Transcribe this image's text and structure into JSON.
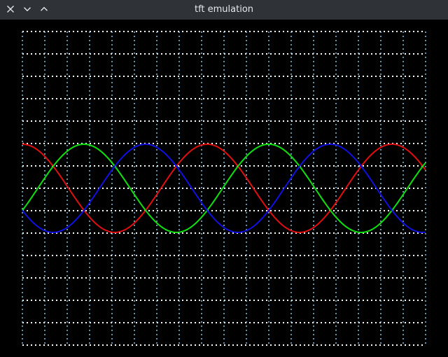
{
  "window": {
    "title": "tft emulation",
    "controls": [
      {
        "name": "close",
        "icon": "close-icon"
      },
      {
        "name": "minimize",
        "icon": "chevron-down-icon"
      },
      {
        "name": "maximize",
        "icon": "chevron-up-icon"
      }
    ]
  },
  "colors": {
    "titlebar": "#2f3337",
    "background": "#000000",
    "grid_h": "#ffffff",
    "grid_v": "#7fc8e8",
    "series_red": "#e01010",
    "series_green": "#10e010",
    "series_blue": "#1010e0"
  },
  "chart_data": {
    "type": "line",
    "grid": true,
    "series": [
      {
        "color": "#e01010",
        "phase_deg": 0
      },
      {
        "color": "#10e010",
        "phase_deg": 120
      },
      {
        "color": "#1010e0",
        "phase_deg": 240
      }
    ]
  }
}
